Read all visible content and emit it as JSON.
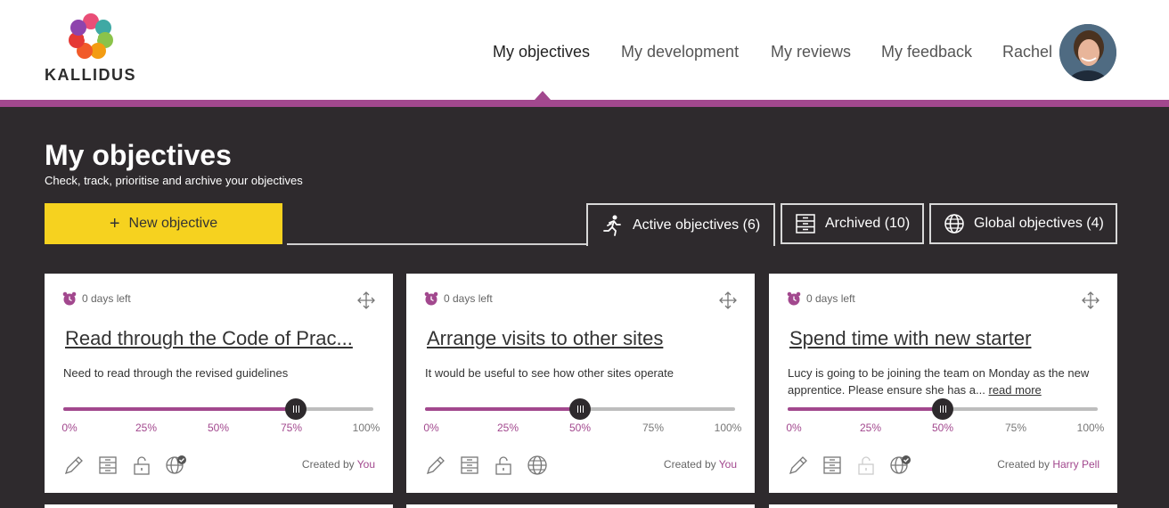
{
  "header": {
    "brand": "KALLIDUS",
    "nav": [
      {
        "label": "My objectives",
        "active": true
      },
      {
        "label": "My development",
        "active": false
      },
      {
        "label": "My reviews",
        "active": false
      },
      {
        "label": "My feedback",
        "active": false
      },
      {
        "label": "Rachel",
        "active": false
      }
    ]
  },
  "page": {
    "title": "My objectives",
    "subtitle": "Check, track, prioritise and archive your objectives",
    "new_button": "New objective"
  },
  "tabs": [
    {
      "label": "Active objectives (6)",
      "icon": "running-person-icon",
      "active": true
    },
    {
      "label": "Archived (10)",
      "icon": "archive-drawer-icon",
      "active": false
    },
    {
      "label": "Global objectives (4)",
      "icon": "globe-icon",
      "active": false
    }
  ],
  "cards": [
    {
      "days_left": "0 days left",
      "title": "Read through the Code of Prac...",
      "description": "Need to read through the revised guidelines",
      "read_more": "",
      "progress": 0.75,
      "created_by_label": "Created by",
      "created_by": "You"
    },
    {
      "days_left": "0 days left",
      "title": "Arrange visits to other sites",
      "description": "It would be useful to see how other sites operate",
      "read_more": "",
      "progress": 0.5,
      "created_by_label": "Created by",
      "created_by": "You"
    },
    {
      "days_left": "0 days left",
      "title": "Spend time with new starter",
      "description": "Lucy is going to be joining the team on Monday as the new apprentice. Please ensure she has a...",
      "read_more": "read more",
      "progress": 0.5,
      "created_by_label": "Created by",
      "created_by": "Harry Pell"
    }
  ],
  "progress_ticks": [
    "0%",
    "25%",
    "50%",
    "75%",
    "100%"
  ],
  "colors": {
    "accent": "#a2488e",
    "button": "#f6d21f",
    "background": "#2e2a2d"
  }
}
